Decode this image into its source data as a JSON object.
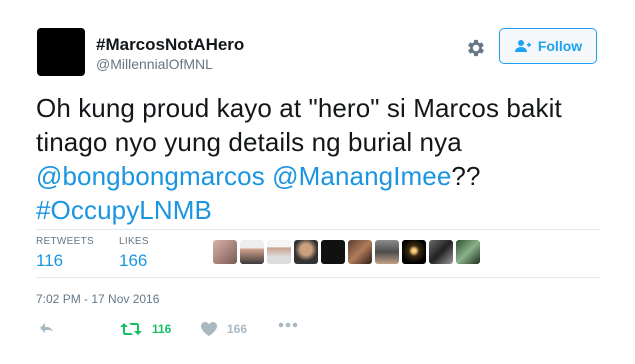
{
  "tweet": {
    "display_name": "#MarcosNotAHero",
    "handle": "@MillennialOfMNL",
    "follow_label": "Follow",
    "text_line1": "Oh kung proud kayo at \"hero\" si Marcos bakit",
    "text_line2": "tinago nyo yung details ng burial nya",
    "mention1": "@bongbongmarcos",
    "mention2": "@ManangImee",
    "text_after_mentions": "??",
    "hashtag": "#OccupyLNMB",
    "retweets_label": "RETWEETS",
    "retweets_count": "116",
    "likes_label": "LIKES",
    "likes_count": "166",
    "timestamp": "7:02 PM - 17 Nov 2016",
    "action_retweet_count": "116",
    "action_like_count": "166"
  },
  "icons": [
    "gear-icon",
    "follow-user-icon",
    "reply-icon",
    "retweet-icon",
    "like-heart-icon",
    "more-dots-icon"
  ],
  "colors": {
    "accent": "#1da1f2",
    "link": "#1b95e0",
    "retweet_green": "#17bf63",
    "muted": "#657786",
    "divider": "#e1e8ed"
  }
}
